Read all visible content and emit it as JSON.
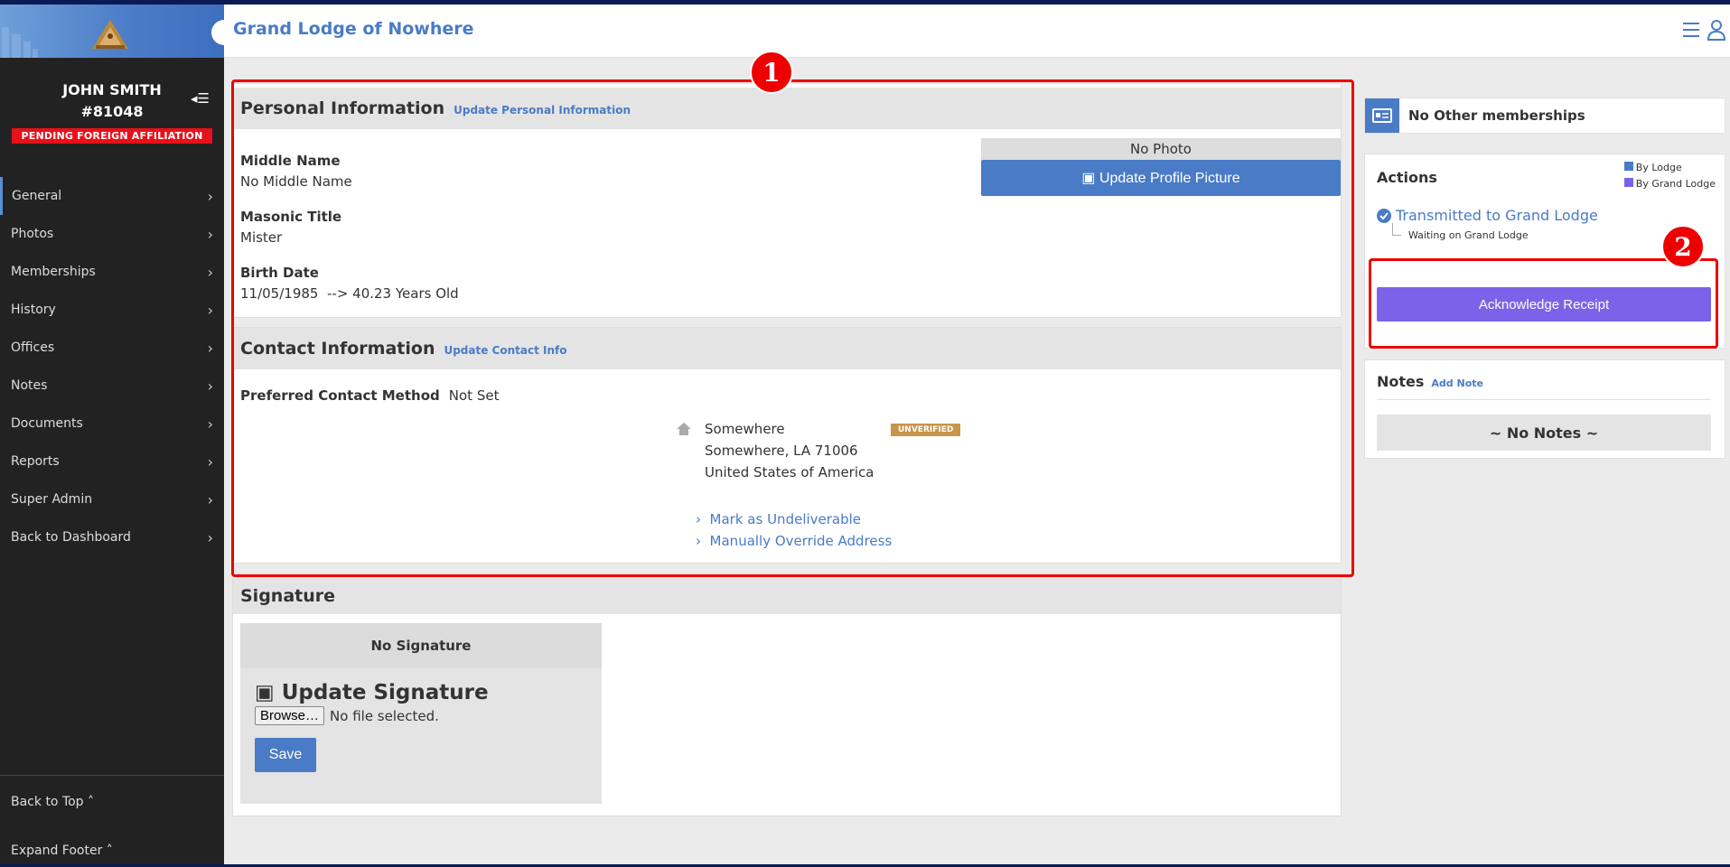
{
  "header": {
    "title": "Grand Lodge of Nowhere"
  },
  "user": {
    "name": "JOHN SMITH",
    "id": "#81048",
    "status_badge": "PENDING FOREIGN AFFILIATION"
  },
  "sidebar": {
    "items": [
      {
        "label": "General"
      },
      {
        "label": "Photos"
      },
      {
        "label": "Memberships"
      },
      {
        "label": "History"
      },
      {
        "label": "Offices"
      },
      {
        "label": "Notes"
      },
      {
        "label": "Documents"
      },
      {
        "label": "Reports"
      },
      {
        "label": "Super Admin"
      },
      {
        "label": "Back to Dashboard"
      }
    ],
    "back_to_top": "Back to Top",
    "expand_footer": "Expand Footer"
  },
  "personal": {
    "title": "Personal Information",
    "update_link": "Update Personal Information",
    "middle_name_label": "Middle Name",
    "middle_name_value": "No Middle Name",
    "masonic_title_label": "Masonic Title",
    "masonic_title_value": "Mister",
    "birth_date_label": "Birth Date",
    "birth_date_value": "11/05/1985  --> 40.23 Years Old",
    "no_photo": "No Photo",
    "update_picture": "Update Profile Picture"
  },
  "contact": {
    "title": "Contact Information",
    "update_link": "Update Contact Info",
    "preferred_label": "Preferred Contact Method",
    "preferred_value": "Not Set",
    "address_line1": "Somewhere",
    "address_line2": "Somewhere, LA 71006",
    "address_line3": "United States of America",
    "unverified": "UNVERIFIED",
    "mark_undeliverable": "Mark as Undeliverable",
    "override_address": "Manually Override Address"
  },
  "signature": {
    "title": "Signature",
    "no_signature": "No Signature",
    "update_label": "Update Signature",
    "browse": "Browse…",
    "no_file": "No file selected.",
    "save": "Save"
  },
  "right": {
    "memberships": "No Other memberships",
    "actions_title": "Actions",
    "legend_lodge": "By Lodge",
    "legend_grand_lodge": "By Grand Lodge",
    "transmitted": "Transmitted to Grand Lodge",
    "waiting": "Waiting on Grand Lodge",
    "acknowledge": "Acknowledge Receipt",
    "notes_title": "Notes",
    "add_note": "Add Note",
    "no_notes": "~ No Notes ~"
  },
  "markers": {
    "one": "1",
    "two": "2"
  },
  "colors": {
    "accent": "#4a7bc6",
    "purple": "#7a63e8",
    "danger": "#e8101a",
    "unverified": "#c8954a"
  }
}
